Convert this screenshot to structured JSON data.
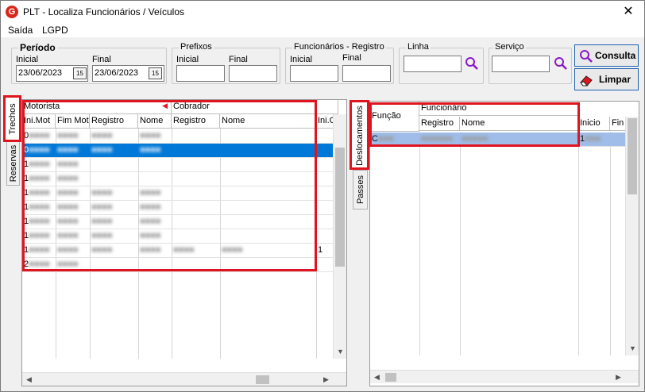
{
  "window": {
    "title": "PLT - Localiza Funcionários / Veículos",
    "icon_letter": "G",
    "close_glyph": "✕"
  },
  "menu": [
    "Saída",
    "LGPD"
  ],
  "periodo": {
    "legend": "Período",
    "inicial_label": "Inicial",
    "final_label": "Final",
    "inicial_value": "23/06/2023",
    "final_value": "23/06/2023",
    "cal_glyph": "15"
  },
  "prefixos": {
    "legend": "Prefixos",
    "inicial_label": "Inicial",
    "final_label": "Final",
    "inicial_value": "",
    "final_value": ""
  },
  "funcionarios": {
    "legend": "Funcionários - Registro",
    "inicial_label": "Inicial",
    "final_label": "Final",
    "inicial_value": "",
    "final_value": ""
  },
  "linha": {
    "legend": "Linha",
    "value": ""
  },
  "servico": {
    "legend": "Serviço",
    "value": ""
  },
  "buttons": {
    "consulta": "Consulta",
    "limpar": "Limpar"
  },
  "left_tabs": [
    "Trechos",
    "Reservas"
  ],
  "right_tabs": [
    "Deslocamentos",
    "Passes"
  ],
  "left_grid": {
    "group_motorista": "Motorista",
    "group_cobrador": "Cobrador",
    "columns": [
      "Ini.Mot",
      "Fim Mot",
      "Registro",
      "Nome",
      "Registro",
      "Nome",
      "Ini.C"
    ],
    "rows": [
      [
        "0",
        "",
        "",
        "",
        "",
        "",
        ""
      ],
      [
        "0",
        "",
        "",
        "",
        "",
        "",
        ""
      ],
      [
        "1",
        "",
        "",
        "",
        "",
        "",
        ""
      ],
      [
        "1",
        "",
        "",
        "",
        "",
        "",
        ""
      ],
      [
        "1",
        "",
        "",
        "",
        "",
        "",
        ""
      ],
      [
        "1",
        "",
        "",
        "",
        "",
        "",
        ""
      ],
      [
        "1",
        "",
        "",
        "",
        "",
        "",
        ""
      ],
      [
        "1",
        "",
        "",
        "",
        "",
        "",
        ""
      ],
      [
        "1",
        "",
        "",
        "",
        "",
        "",
        "1"
      ],
      [
        "2",
        "",
        "",
        "",
        "",
        "",
        ""
      ]
    ],
    "selected_row": 1
  },
  "right_grid": {
    "col_funcao": "Função",
    "group_funcionario": "Funcionário",
    "columns": [
      "Registro",
      "Nome",
      "Inicio",
      "Fin"
    ],
    "rows": [
      [
        "C",
        "",
        "",
        "1",
        ""
      ]
    ]
  }
}
